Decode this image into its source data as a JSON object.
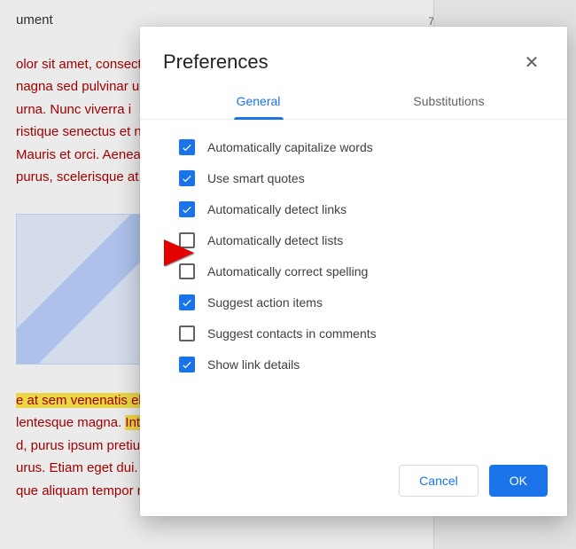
{
  "background": {
    "title_fragment": "ument",
    "page_number": "7",
    "para1": "olor sit amet, consectet\nnagna sed pulvinar ul\n urna. Nunc viverra i\nristique senectus et n\n Mauris et orci. Aenea\npurus, scelerisque at,",
    "para2_hl1": "e at sem venenatis eleif",
    "para2_txt1": "lentesque magna. ",
    "para2_hl2": "Integ",
    "para2_txt2": "d, purus ipsum pretium\nurus. Etiam eget dui. Ali\nque aliquam tempor magn"
  },
  "dialog": {
    "title": "Preferences",
    "tabs": {
      "general": "General",
      "substitutions": "Substitutions",
      "active": "general"
    },
    "options": [
      {
        "key": "capitalize",
        "label": "Automatically capitalize words",
        "checked": true
      },
      {
        "key": "smartquotes",
        "label": "Use smart quotes",
        "checked": true
      },
      {
        "key": "detectlinks",
        "label": "Automatically detect links",
        "checked": true
      },
      {
        "key": "detectlists",
        "label": "Automatically detect lists",
        "checked": false
      },
      {
        "key": "correctspelling",
        "label": "Automatically correct spelling",
        "checked": false
      },
      {
        "key": "actionitems",
        "label": "Suggest action items",
        "checked": true
      },
      {
        "key": "contacts",
        "label": "Suggest contacts in comments",
        "checked": false
      },
      {
        "key": "linkdetails",
        "label": "Show link details",
        "checked": true
      }
    ],
    "buttons": {
      "cancel": "Cancel",
      "ok": "OK"
    }
  }
}
